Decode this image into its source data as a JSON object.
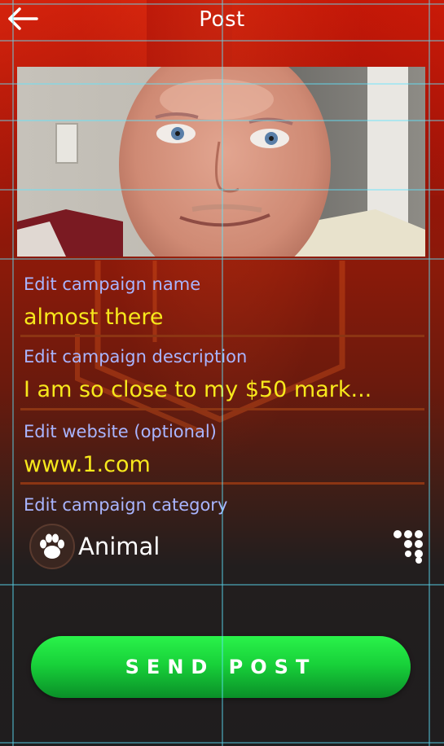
{
  "header": {
    "title": "Post",
    "back_icon": "arrow-left-icon"
  },
  "photo": {
    "subject": "selfie of a bald man smiling"
  },
  "fields": {
    "name": {
      "label": "Edit campaign name",
      "value": "almost there"
    },
    "description": {
      "label": "Edit campaign description",
      "value": "I am so close to my $50 mark..."
    },
    "website": {
      "label": "Edit website (optional)",
      "value": "www.1.com"
    },
    "category": {
      "label": "Edit campaign category",
      "value": "Animal",
      "icon": "paw-icon"
    }
  },
  "more_icon": "dots-grid-icon",
  "send_button": {
    "label": "SEND POST"
  },
  "colors": {
    "label": "#a9b5ff",
    "value": "#f7e81c",
    "underline": "#8c3513",
    "button": "#18d23a",
    "guide": "#5fe6ff"
  }
}
